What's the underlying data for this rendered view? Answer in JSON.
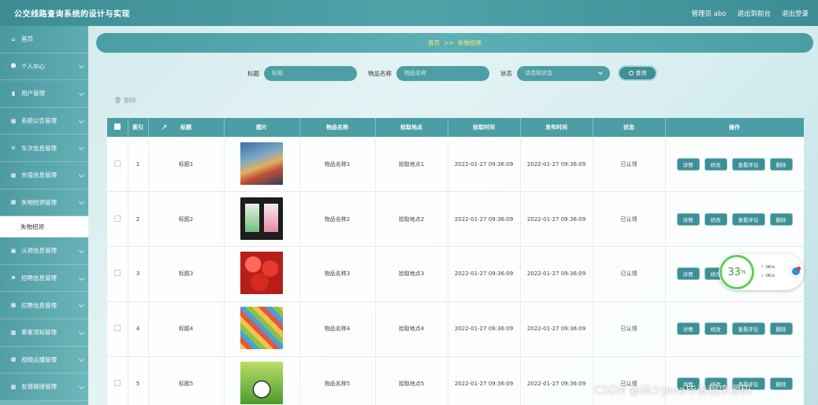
{
  "app": {
    "title": "公交线路查询系统的设计与实现",
    "admin": "管理员 abo",
    "back_to_front": "退出到前台",
    "logout": "退出登录"
  },
  "sidebar": {
    "items": [
      {
        "label": "首页",
        "icon": "home-icon"
      },
      {
        "label": "个人中心",
        "icon": "user-icon"
      },
      {
        "label": "用户管理",
        "icon": "bar-chart-icon"
      },
      {
        "label": "系统公告管理",
        "icon": "grid-icon"
      },
      {
        "label": "车次信息管理",
        "icon": "list-icon"
      },
      {
        "label": "充值信息管理",
        "icon": "table-icon"
      },
      {
        "label": "失物招领管理",
        "icon": "grid-icon"
      },
      {
        "label": "认领信息管理",
        "icon": "box-icon"
      },
      {
        "label": "招聘信息管理",
        "icon": "flag-icon"
      },
      {
        "label": "应聘信息管理",
        "icon": "grid-icon"
      },
      {
        "label": "乘客须知管理",
        "icon": "grid-icon"
      },
      {
        "label": "视频点播管理",
        "icon": "grid-icon"
      },
      {
        "label": "友情链接管理",
        "icon": "grid-icon"
      }
    ],
    "active_sub": "失物招领"
  },
  "breadcrumb": {
    "home": "首页",
    "sep": ">>",
    "current": "失物招领"
  },
  "search": {
    "title_label": "标题",
    "title_placeholder": "标题",
    "item_label": "物品名称",
    "item_placeholder": "物品名称",
    "status_label": "状态",
    "status_placeholder": "请选择状态",
    "search_button": "查询"
  },
  "toolbar": {
    "delete_label": "删除"
  },
  "table": {
    "headers": [
      "",
      "索引",
      "标题",
      "图片",
      "物品名称",
      "拾取地点",
      "拾取时间",
      "发布时间",
      "状态",
      "操作"
    ],
    "rows": [
      {
        "index": "1",
        "title": "标题1",
        "item": "物品名称1",
        "place": "拾取地点1",
        "pick_time": "2022-01-27 09:36:09",
        "publish_time": "2022-01-27 09:36:09",
        "status": "已认领"
      },
      {
        "index": "2",
        "title": "标题2",
        "item": "物品名称2",
        "place": "拾取地点2",
        "pick_time": "2022-01-27 09:36:09",
        "publish_time": "2022-01-27 09:36:09",
        "status": "已认领"
      },
      {
        "index": "3",
        "title": "标题3",
        "item": "物品名称3",
        "place": "拾取地点3",
        "pick_time": "2022-01-27 09:36:09",
        "publish_time": "2022-01-27 09:36:09",
        "status": "已认领"
      },
      {
        "index": "4",
        "title": "标题4",
        "item": "物品名称4",
        "place": "拾取地点4",
        "pick_time": "2022-01-27 09:36:09",
        "publish_time": "2022-01-27 09:36:09",
        "status": "已认领"
      },
      {
        "index": "5",
        "title": "标题5",
        "item": "物品名称5",
        "place": "拾取地点5",
        "pick_time": "2022-01-27 09:36:09",
        "publish_time": "2022-01-27 09:36:09",
        "status": "已认领"
      }
    ],
    "actions": {
      "detail": "详情",
      "edit": "修改",
      "comments": "查看评论",
      "delete": "删除"
    }
  },
  "speed_widget": {
    "percent": "33",
    "percent_sign": "%",
    "up": "0K/s",
    "down": "0K/s"
  },
  "watermark": "CSDN @林少Java毕设程序源码",
  "colors": {
    "primary": "#4a9ea4",
    "topbar": "#3d8c94",
    "breadcrumb_text": "#ffe680",
    "progress": "#5bcf5b"
  }
}
